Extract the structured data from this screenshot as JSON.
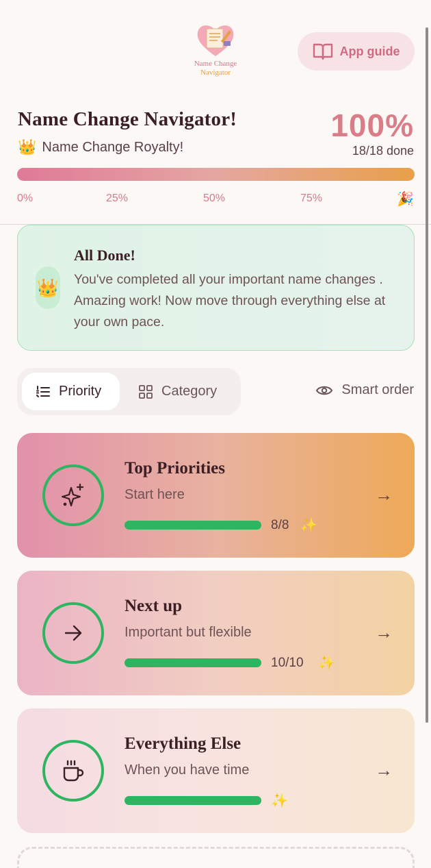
{
  "header": {
    "logo_line1": "Name Change",
    "logo_line2": "Navigator",
    "guide_label": "App guide"
  },
  "progress": {
    "title": "Name Change Navigator!",
    "crown_emoji": "👑",
    "subtitle": "Name Change Royalty!",
    "percent_label": "100%",
    "done_label": "18/18 done",
    "fraction": 1.0,
    "ticks": [
      "0%",
      "25%",
      "50%",
      "75%"
    ],
    "end_emoji": "🎉"
  },
  "done_card": {
    "emoji": "👑",
    "title": "All Done!",
    "text": "You've completed all your important name changes . Amazing work! Now move through everything else at your own pace."
  },
  "view_toggle": {
    "priority_label": "Priority",
    "category_label": "Category",
    "active": "Priority",
    "smart_order_label": "Smart order"
  },
  "tiers": [
    {
      "title": "Top Priorities",
      "subtitle": "Start here",
      "count": "8/8",
      "fraction": 1.0,
      "spark": "✨",
      "arrow": "→",
      "icon": "sparkles-icon"
    },
    {
      "title": "Next up",
      "subtitle": "Important but flexible",
      "count": "10/10",
      "fraction": 1.0,
      "spark": "✨",
      "arrow": "→",
      "icon": "arrow-right-icon"
    },
    {
      "title": "Everything Else",
      "subtitle": "When you have time",
      "count": "",
      "fraction": 1.0,
      "spark": "✨",
      "arrow": "→",
      "icon": "coffee-cup-icon"
    }
  ],
  "colors": {
    "accent": "#cf6a81",
    "success": "#2fb561",
    "background": "#fbf8f5"
  }
}
